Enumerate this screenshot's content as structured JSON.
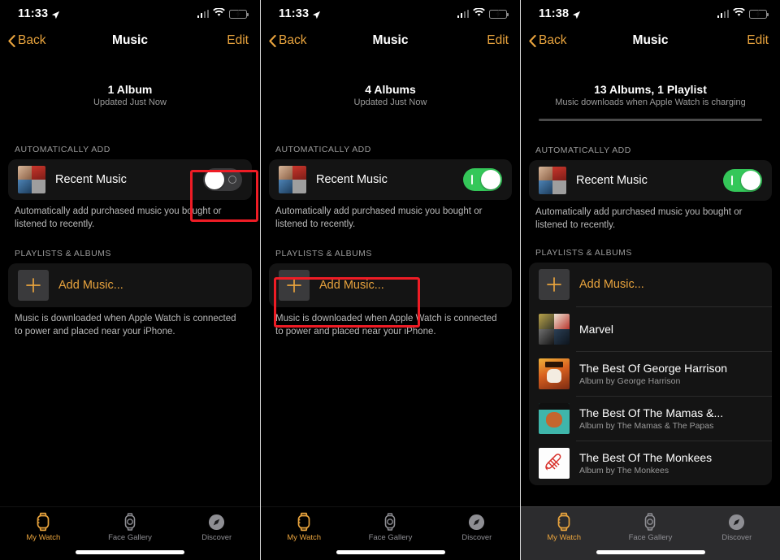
{
  "colors": {
    "accent": "#e8a33d",
    "toggle_on": "#34c759",
    "toggle_off": "#3a3a3c",
    "highlight": "#ee1c25",
    "background": "#000000",
    "card": "#141414",
    "secondary_text": "#9a9a9a"
  },
  "nav": {
    "back_label": "Back",
    "title": "Music",
    "edit_label": "Edit",
    "back_icon": "chevron-left-icon"
  },
  "status_icons": {
    "location": "location-arrow-icon",
    "cellular": "cellular-bars-icon",
    "wifi": "wifi-icon",
    "battery": "battery-charging-icon"
  },
  "sections": {
    "auto_add_header": "AUTOMATICALLY ADD",
    "playlists_header": "PLAYLISTS & ALBUMS",
    "recent_music_label": "Recent Music",
    "auto_add_footer": "Automatically add purchased music you bought or listened to recently.",
    "add_music_label": "Add Music...",
    "download_footer": "Music is downloaded when Apple Watch is connected to power and placed near your iPhone.",
    "plus_icon": "plus-icon"
  },
  "tabs": [
    {
      "label": "My Watch",
      "icon": "apple-watch-icon",
      "active": true
    },
    {
      "label": "Face Gallery",
      "icon": "watch-face-icon",
      "active": false
    },
    {
      "label": "Discover",
      "icon": "compass-icon",
      "active": false
    }
  ],
  "panels": [
    {
      "status_time": "11:33",
      "summary_title": "1 Album",
      "summary_subtitle": "Updated Just Now",
      "toggle_state": "off",
      "has_progress_bar": false,
      "highlight_target": "recent-music-toggle",
      "albums": []
    },
    {
      "status_time": "11:33",
      "summary_title": "4 Albums",
      "summary_subtitle": "Updated Just Now",
      "toggle_state": "on",
      "has_progress_bar": false,
      "highlight_target": "add-music-row",
      "albums": []
    },
    {
      "status_time": "11:38",
      "summary_title": "13 Albums, 1 Playlist",
      "summary_subtitle": "Music downloads when Apple Watch is charging",
      "toggle_state": "on",
      "has_progress_bar": true,
      "highlight_target": "none",
      "albums": [
        {
          "title": "Marvel",
          "subtitle": ""
        },
        {
          "title": "The Best Of George Harrison",
          "subtitle": "Album by George Harrison"
        },
        {
          "title": "The Best Of The Mamas &...",
          "subtitle": "Album by The Mamas & The Papas"
        },
        {
          "title": "The Best Of The Monkees",
          "subtitle": "Album by The Monkees"
        }
      ]
    }
  ]
}
